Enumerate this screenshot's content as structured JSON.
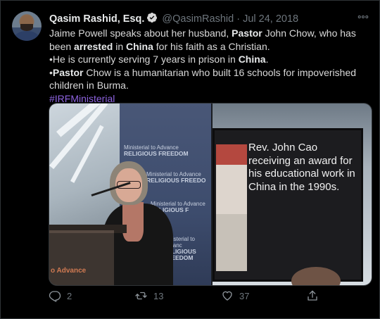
{
  "tweet": {
    "author_name": "Qasim Rashid, Esq.",
    "handle": "@QasimRashid",
    "separator": "·",
    "date": "Jul 24, 2018",
    "more_icon": "more-icon",
    "verified_icon": "verified-badge-icon",
    "text": {
      "p1_a": "Jaime Powell speaks about her husband, ",
      "p1_b": "Pastor",
      "p1_c": " John Chow, who has been ",
      "p1_d": "arrested",
      "p1_e": " in ",
      "p1_f": "China",
      "p1_g": " for his faith as a Christian.",
      "p2_a": "•He is currently serving 7 years in prison in ",
      "p2_b": "China",
      "p2_c": ".",
      "p3_a": "•",
      "p3_b": "Pastor",
      "p3_c": " Chow is a humanitarian who built 16 schools for impoverished children in Burma.",
      "hashtag": "#IRFMinisterial"
    },
    "media": {
      "left_banner_small_1": "Ministerial to Advance",
      "left_banner_big_1": "RELIGIOUS FREEDOM",
      "left_banner_small_2": "Ministerial to Advance",
      "left_banner_big_2": "RELIGIOUS FREEDO",
      "left_banner_small_3": "Ministerial to Advance",
      "left_banner_big_3": "RELIGIOUS F",
      "left_banner_small_4": "Ministerial to Advanc",
      "left_banner_big_4": "RELIGIOUS FREEDOM",
      "podium_text": "o Advance",
      "screen_caption": "Rev. John Cao receiving an award for his educational work in China in the 1990s."
    },
    "actions": {
      "reply_count": "2",
      "retweet_count": "13",
      "like_count": "37",
      "reply_icon": "reply-icon",
      "retweet_icon": "retweet-icon",
      "like_icon": "heart-icon",
      "share_icon": "share-icon"
    },
    "colors": {
      "background": "#000000",
      "hashtag": "#8e63e0",
      "muted": "#6e767d",
      "verified": "#1d9bf0"
    }
  }
}
